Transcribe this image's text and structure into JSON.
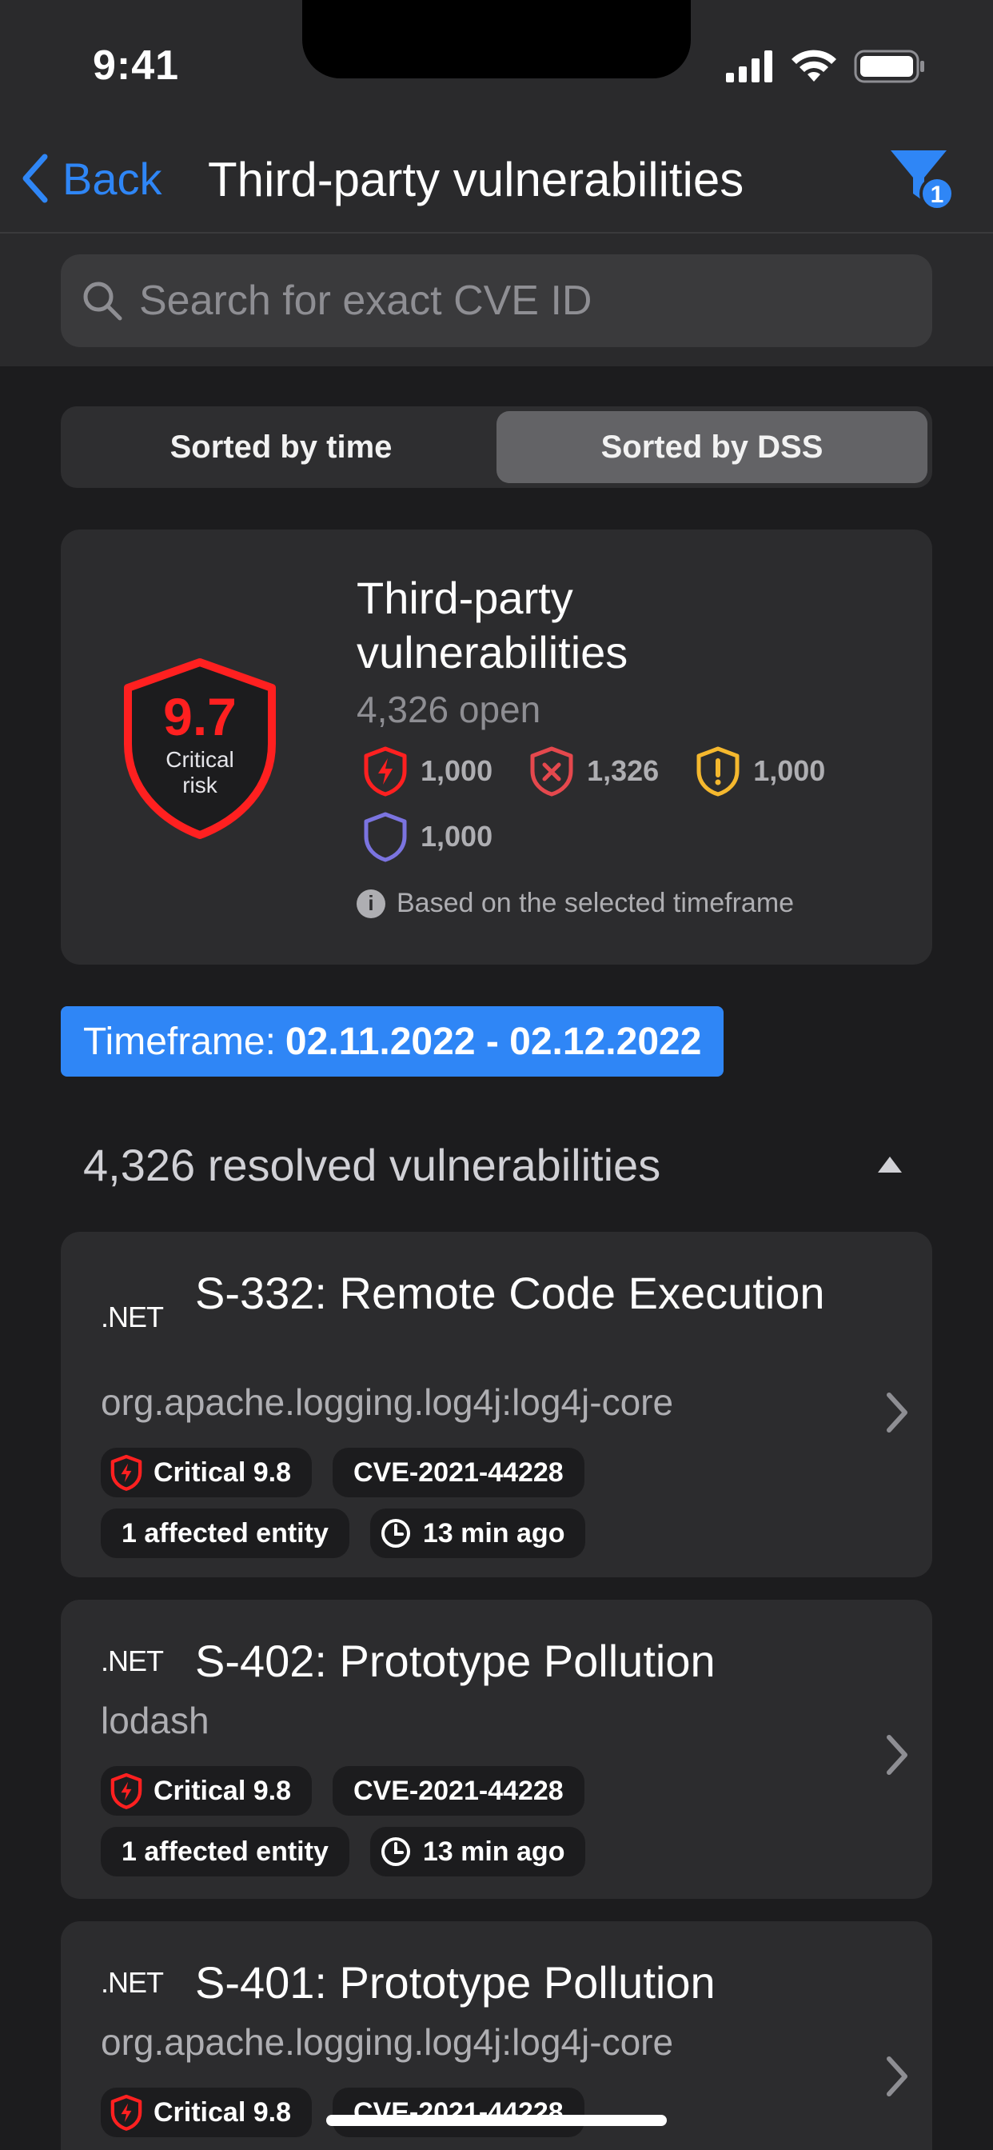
{
  "status_bar": {
    "time": "9:41"
  },
  "nav": {
    "back_label": "Back",
    "title": "Third-party vulnerabilities",
    "filter_count": "1"
  },
  "search": {
    "placeholder": "Search for exact CVE ID"
  },
  "sort": {
    "options": [
      "Sorted by time",
      "Sorted by DSS"
    ],
    "selected": "Sorted by DSS"
  },
  "summary": {
    "score": "9.7",
    "risk_label": "Critical risk",
    "title": "Third-party vulnerabilities",
    "open": "4,326 open",
    "severity_counts": [
      {
        "icon": "critical-shield-icon",
        "value": "1,000",
        "color": "#ff2020"
      },
      {
        "icon": "high-shield-icon",
        "value": "1,326",
        "color": "#e5484d"
      },
      {
        "icon": "medium-shield-icon",
        "value": "1,000",
        "color": "#f5b82e"
      },
      {
        "icon": "low-shield-icon",
        "value": "1,000",
        "color": "#7b74e0"
      }
    ],
    "note": "Based on the selected timeframe"
  },
  "timeframe": {
    "label": "Timeframe:",
    "range": "02.11.2022 - 02.12.2022"
  },
  "resolved_header": "4,326 resolved vulnerabilities",
  "vulnerabilities": [
    {
      "lang": ".NET",
      "title": "S-332: Remote Code Execution",
      "package": "org.apache.logging.log4j:log4j-core",
      "severity": "Critical 9.8",
      "cve": "CVE-2021-44228",
      "affected": "1 affected entity",
      "time": "13 min ago"
    },
    {
      "lang": ".NET",
      "title": "S-402: Prototype Pollution",
      "package": "lodash",
      "severity": "Critical 9.8",
      "cve": "CVE-2021-44228",
      "affected": "1 affected entity",
      "time": "13 min ago"
    },
    {
      "lang": ".NET",
      "title": "S-401: Prototype Pollution",
      "package": "org.apache.logging.log4j:log4j-core",
      "severity": "Critical 9.8",
      "cve": "CVE-2021-44228"
    }
  ],
  "colors": {
    "accent": "#2f86f6",
    "critical": "#ff2020",
    "background": "#1c1c1e",
    "card": "#2c2c2e"
  }
}
